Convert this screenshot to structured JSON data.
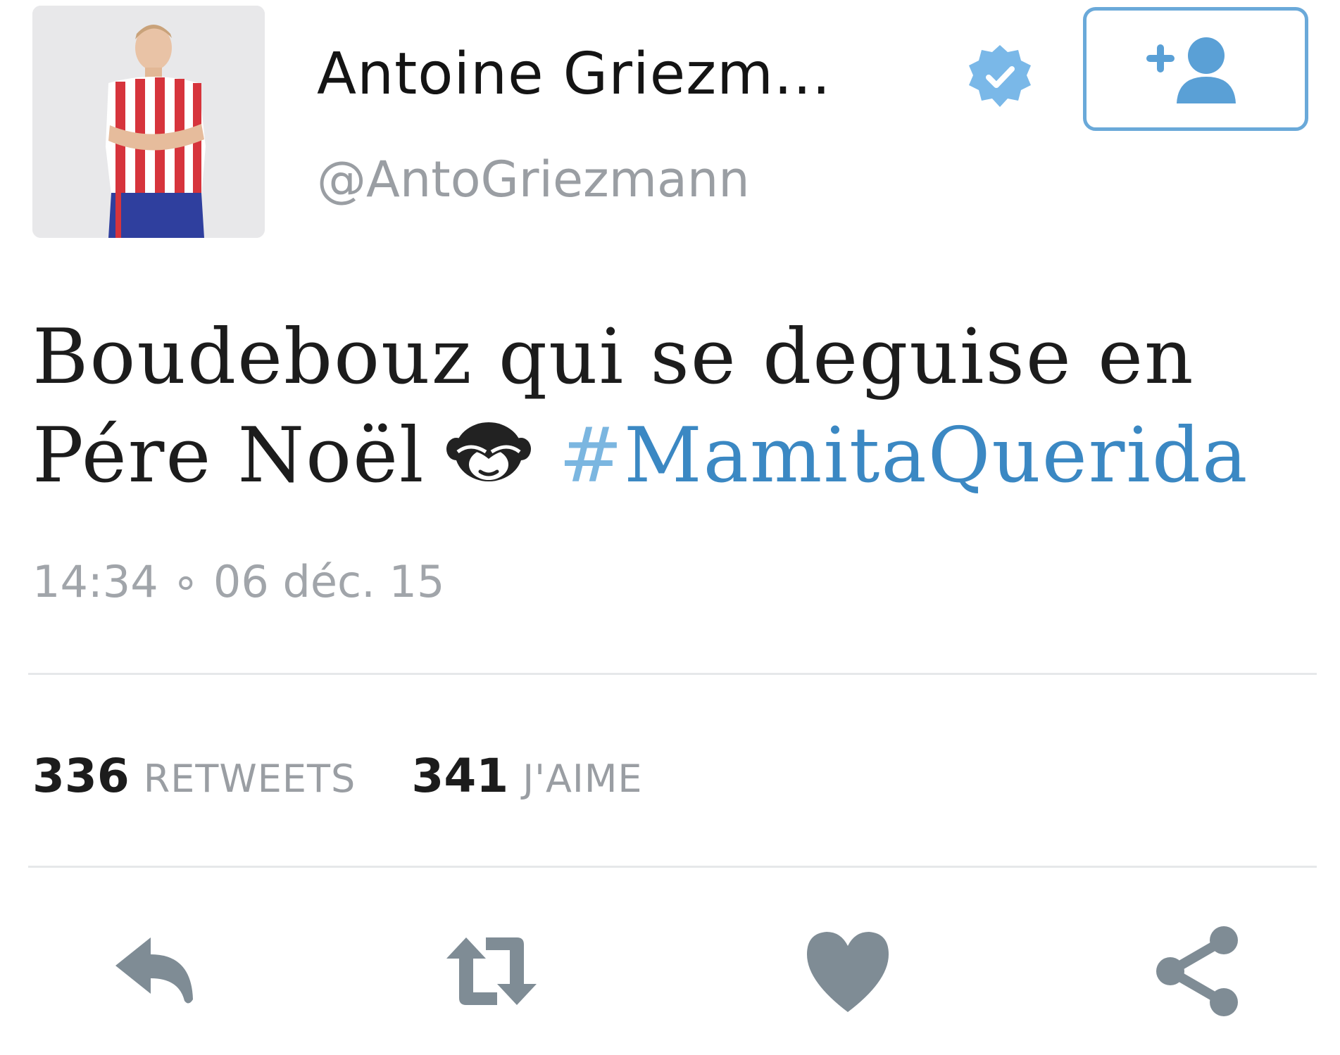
{
  "author": {
    "display_name": "Antoine Griezm...",
    "handle": "@AntoGriezmann",
    "verified": true,
    "avatar_icon": "player-avatar"
  },
  "follow_button": {
    "icon": "follow-user-icon"
  },
  "tweet": {
    "line1": "Boudebouz qui se deguise en",
    "line2_text": "Pére Noël",
    "emoji_icon": "see-no-evil-icon",
    "hashtag_symbol": "#",
    "hashtag_word": "MamitaQuerida",
    "timestamp": "14:34 ∘ 06 déc. 15"
  },
  "stats": {
    "retweets_count": "336",
    "retweets_label": "RETWEETS",
    "likes_count": "341",
    "likes_label": "J'AIME"
  },
  "actions": [
    "reply-icon",
    "retweet-icon",
    "like-icon",
    "share-icon"
  ],
  "colors": {
    "accent": "#3b88c3",
    "follow_border": "#6aa9d9",
    "muted_text": "#9a9ea3",
    "action_icon": "#7f8c95",
    "verified": "#7ab8e8"
  }
}
